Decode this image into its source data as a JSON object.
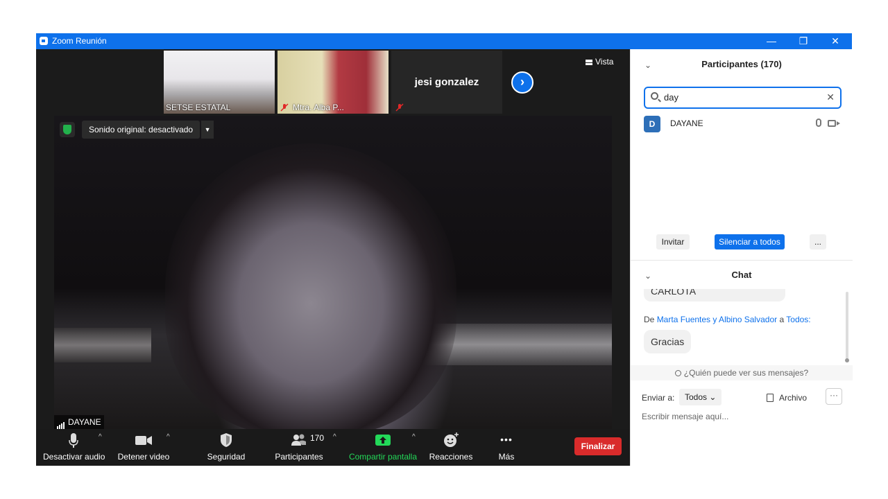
{
  "window": {
    "title": "Zoom Reunión",
    "controls": {
      "minimize": "—",
      "restore": "❐",
      "close": "✕"
    }
  },
  "thumbnails": [
    {
      "caption": "SETSE ESTATAL",
      "muted": false
    },
    {
      "caption": "Mtra. Alba P...",
      "muted": true
    },
    {
      "name": "jesi gonzalez",
      "muted": true
    }
  ],
  "next_icon": "›",
  "view": {
    "label": "Vista"
  },
  "main_video": {
    "audio_status": "Sonido original: desactivado",
    "speaker_name": "DAYANE"
  },
  "toolbar": {
    "mute": "Desactivar audio",
    "video": "Detener video",
    "security": "Seguridad",
    "participants": "Participantes",
    "participants_count": "170",
    "share": "Compartir pantalla",
    "reactions": "Reacciones",
    "more": "Más",
    "end": "Finalizar",
    "more_glyph": "•••",
    "caret": "^"
  },
  "participants_panel": {
    "title": "Participantes (170)",
    "search_value": "day",
    "clear": "✕",
    "rows": [
      {
        "initial": "D",
        "name": "DAYANE"
      }
    ],
    "buttons": {
      "invite": "Invitar",
      "mute_all": "Silenciar a todos",
      "more": "..."
    }
  },
  "chat_panel": {
    "title": "Chat",
    "messages": [
      {
        "text": "CARLOTA"
      },
      {
        "from_prefix": "De",
        "from": "Marta Fuentes y Albino Salvador",
        "to_prefix": "a",
        "to": "Todos:",
        "text": "Gracias"
      }
    ],
    "privacy_note": "¿Quién puede ver sus mensajes?",
    "send_to_label": "Enviar a:",
    "send_to_value": "Todos",
    "file_label": "Archivo",
    "more": "···",
    "input_placeholder": "Escribir mensaje aquí..."
  },
  "colors": {
    "accent": "#0e71eb",
    "end_red": "#d92b2b",
    "share_green": "#23d959",
    "toolbar_bg": "#1a1a1a"
  }
}
